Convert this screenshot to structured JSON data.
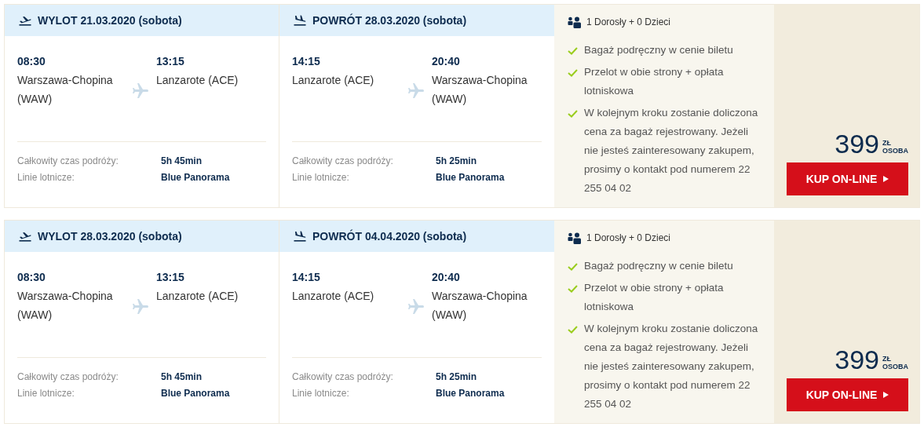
{
  "offers": [
    {
      "legs": [
        {
          "kind": "departure",
          "title": "WYLOT 21.03.2020 (sobota)",
          "from_time": "08:30",
          "from_airport": "Warszawa-Chopina (WAW)",
          "to_time": "13:15",
          "to_airport": "Lanzarote (ACE)",
          "details": [
            {
              "label": "Całkowity czas podróży:",
              "value": "5h 45min"
            },
            {
              "label": "Linie lotnicze:",
              "value": "Blue Panorama"
            }
          ]
        },
        {
          "kind": "return",
          "title": "POWRÓT 28.03.2020 (sobota)",
          "from_time": "14:15",
          "from_airport": "Lanzarote (ACE)",
          "to_time": "20:40",
          "to_airport": "Warszawa-Chopina (WAW)",
          "details": [
            {
              "label": "Całkowity czas podróży:",
              "value": "5h 25min"
            },
            {
              "label": "Linie lotnicze:",
              "value": "Blue Panorama"
            }
          ]
        }
      ],
      "passengers": "1 Dorosły + 0 Dzieci",
      "features": [
        "Bagaż podręczny w cenie biletu",
        "Przelot w obie strony + opłata lotniskowa",
        "W kolejnym kroku zostanie doliczona cena za bagaż rejestrowany. Jeżeli nie jesteś zainteresowany zakupem, prosimy o kontakt pod numerem 22 255 04 02"
      ],
      "price": "399",
      "currency": "ZŁ",
      "unit": "OSOBA",
      "button": "KUP ON-LINE"
    },
    {
      "legs": [
        {
          "kind": "departure",
          "title": "WYLOT 28.03.2020 (sobota)",
          "from_time": "08:30",
          "from_airport": "Warszawa-Chopina (WAW)",
          "to_time": "13:15",
          "to_airport": "Lanzarote (ACE)",
          "details": [
            {
              "label": "Całkowity czas podróży:",
              "value": "5h 45min"
            },
            {
              "label": "Linie lotnicze:",
              "value": "Blue Panorama"
            }
          ]
        },
        {
          "kind": "return",
          "title": "POWRÓT 04.04.2020 (sobota)",
          "from_time": "14:15",
          "from_airport": "Lanzarote (ACE)",
          "to_time": "20:40",
          "to_airport": "Warszawa-Chopina (WAW)",
          "details": [
            {
              "label": "Całkowity czas podróży:",
              "value": "5h 25min"
            },
            {
              "label": "Linie lotnicze:",
              "value": "Blue Panorama"
            }
          ]
        }
      ],
      "passengers": "1 Dorosły + 0 Dzieci",
      "features": [
        "Bagaż podręczny w cenie biletu",
        "Przelot w obie strony + opłata lotniskowa",
        "W kolejnym kroku zostanie doliczona cena za bagaż rejestrowany. Jeżeli nie jesteś zainteresowany zakupem, prosimy o kontakt pod numerem 22 255 04 02"
      ],
      "price": "399",
      "currency": "ZŁ",
      "unit": "OSOBA",
      "button": "KUP ON-LINE"
    }
  ]
}
